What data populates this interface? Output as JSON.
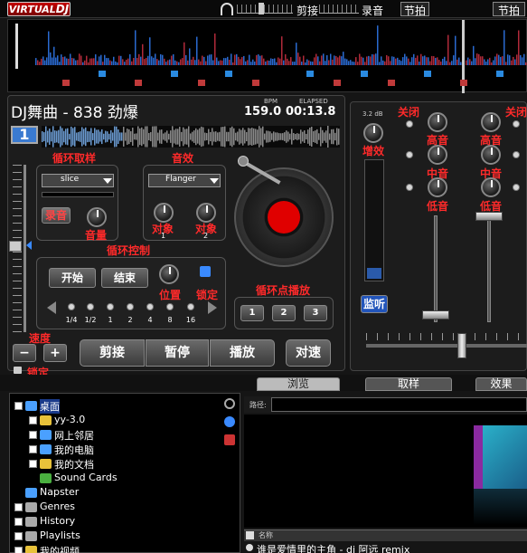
{
  "topbar": {
    "logo_virtual": "VIRTUAL",
    "logo_dj": "DJ",
    "cut_label": "剪接",
    "record_label": "录音",
    "beat_label1": "节拍",
    "beat_label2": "节拍"
  },
  "track": {
    "title": "DJ舞曲 - 838 劲爆",
    "bpm_label": "BPM",
    "elapsed_label": "ELAPSED",
    "bpm": "159.0",
    "elapsed": "00:13.8",
    "deck_number": "1"
  },
  "loop": {
    "title": "循环取样",
    "effect_title": "音效",
    "loop_select": "slice",
    "effect_select": "Flanger",
    "record_btn": "录音",
    "volume": "音量",
    "param1": "对象\n1",
    "param2": "对象\n2",
    "param1a": "对象",
    "param1b": "1",
    "param2a": "对象",
    "param2b": "2"
  },
  "loop_control": {
    "title": "循环控制",
    "start": "开始",
    "end": "结束",
    "position": "位置",
    "lock": "锁定",
    "sizes": [
      "1/4",
      "1/2",
      "1",
      "2",
      "4",
      "8",
      "16"
    ]
  },
  "cue": {
    "title": "循环点播放",
    "buttons": [
      "1",
      "2",
      "3"
    ]
  },
  "speed": {
    "label": "速度",
    "minus": "−",
    "plus": "+",
    "lock": "锁定"
  },
  "transport": {
    "cue": "剪接",
    "pause": "暂停",
    "play": "播放",
    "sync": "对速"
  },
  "mixer": {
    "close1": "关闭",
    "close2": "关闭",
    "gain_db": "3.2 dB",
    "gain": "增效",
    "high1": "高音",
    "mid1": "中音",
    "low1": "低音",
    "high2": "高音",
    "mid2": "中音",
    "low2": "低音",
    "monitor": "监听"
  },
  "tabs": {
    "browse": "浏览",
    "sampler": "取样",
    "effects": "效果"
  },
  "browser": {
    "path_label": "路径:",
    "name_header": "名称",
    "song_row": "谁是爱情里的主角 - dj 阿远 remix",
    "tree": [
      {
        "label": "桌面",
        "indent": 0
      },
      {
        "label": "yy-3.0",
        "indent": 1
      },
      {
        "label": "网上邻居",
        "indent": 1
      },
      {
        "label": "我的电脑",
        "indent": 1
      },
      {
        "label": "我的文档",
        "indent": 1
      },
      {
        "label": "Sound Cards",
        "indent": 1
      },
      {
        "label": "Napster",
        "indent": 0
      },
      {
        "label": "Genres",
        "indent": 0
      },
      {
        "label": "History",
        "indent": 0
      },
      {
        "label": "Playlists",
        "indent": 0
      },
      {
        "label": "我的视频",
        "indent": 0
      }
    ]
  }
}
